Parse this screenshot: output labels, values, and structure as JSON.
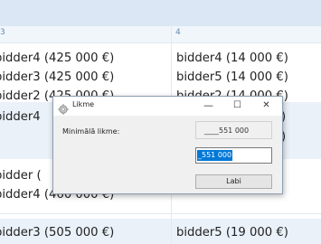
{
  "table": {
    "headers": [
      "3",
      "4"
    ],
    "rows": [
      [
        "bidder4 (425 000 €)",
        "bidder4 (14 000 €)"
      ],
      [
        "bidder3 (425 000 €)",
        "bidder5 (14 000 €)"
      ],
      [
        "bidder2 (425 000 €)",
        "bidder2 (14 000 €)"
      ],
      [
        "bidder4",
        ")"
      ],
      [
        "",
        ")"
      ],
      [
        "bidder (",
        ""
      ],
      [
        "bidder4 (460 000 €)",
        ""
      ],
      [
        "bidder3 (505 000 €)",
        "bidder5 (19 000 €)"
      ]
    ]
  },
  "dialog": {
    "title": "Likme",
    "min_label": "—",
    "max_label": "☐",
    "close_label": "✕",
    "field_label": "Minimālā likme:",
    "min_value": "____551 000",
    "input_value": "_551 000",
    "ok_label": "Labi"
  },
  "colors": {
    "header_bar": "#dbe7f4",
    "band": "#eaf1f9",
    "selection": "#0078d7"
  }
}
